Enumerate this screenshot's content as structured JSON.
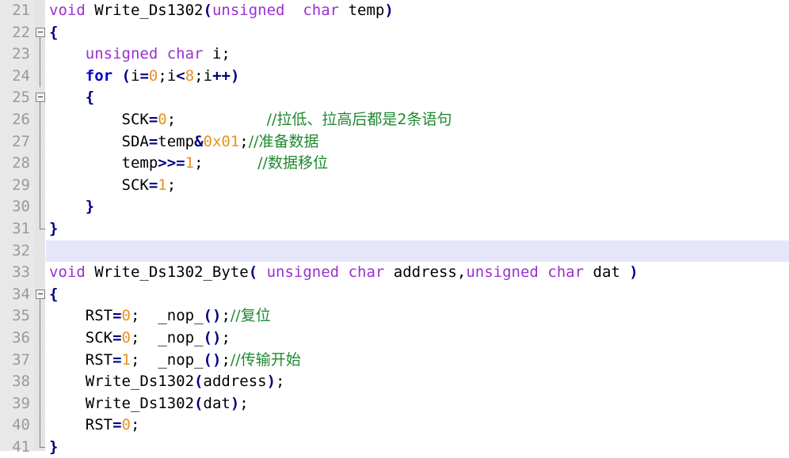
{
  "editor": {
    "title": "C source code editor",
    "language": "C",
    "first_line_number": 21,
    "last_line_number": 41,
    "current_line": 32,
    "colors": {
      "background": "#ffffff",
      "gutter_background": "#e8e8e8",
      "line_number": "#9a9a9a",
      "current_line_highlight": "#e6e6fa",
      "keyword_type": "#9b30d0",
      "keyword_control": "#0000cc",
      "operator": "#00007f",
      "number": "#e8921f",
      "comment": "#1f8a2f",
      "identifier": "#000000"
    },
    "lines": [
      {
        "number": "21",
        "fold": "none",
        "text": "void Write_Ds1302(unsigned  char temp)",
        "tokens": [
          {
            "t": "void",
            "c": "kw-type"
          },
          {
            "t": " ",
            "c": "ident"
          },
          {
            "t": "Write_Ds1302",
            "c": "ident"
          },
          {
            "t": "(",
            "c": "op"
          },
          {
            "t": "unsigned",
            "c": "kw-type"
          },
          {
            "t": "  ",
            "c": "ident"
          },
          {
            "t": "char",
            "c": "kw-type"
          },
          {
            "t": " ",
            "c": "ident"
          },
          {
            "t": "temp",
            "c": "ident"
          },
          {
            "t": ")",
            "c": "op"
          }
        ]
      },
      {
        "number": "22",
        "fold": "box",
        "text": "{",
        "tokens": [
          {
            "t": "{",
            "c": "brace"
          }
        ]
      },
      {
        "number": "23",
        "fold": "line",
        "text": "    unsigned char i;",
        "tokens": [
          {
            "t": "    ",
            "c": "ident"
          },
          {
            "t": "unsigned",
            "c": "kw-type"
          },
          {
            "t": " ",
            "c": "ident"
          },
          {
            "t": "char",
            "c": "kw-type"
          },
          {
            "t": " ",
            "c": "ident"
          },
          {
            "t": "i",
            "c": "ident"
          },
          {
            "t": ";",
            "c": "punc"
          }
        ]
      },
      {
        "number": "24",
        "fold": "line",
        "text": "    for (i=0;i<8;i++)",
        "tokens": [
          {
            "t": "    ",
            "c": "ident"
          },
          {
            "t": "for",
            "c": "kw-ctrl"
          },
          {
            "t": " ",
            "c": "ident"
          },
          {
            "t": "(",
            "c": "op"
          },
          {
            "t": "i",
            "c": "ident"
          },
          {
            "t": "=",
            "c": "op"
          },
          {
            "t": "0",
            "c": "num"
          },
          {
            "t": ";",
            "c": "punc"
          },
          {
            "t": "i",
            "c": "ident"
          },
          {
            "t": "<",
            "c": "op"
          },
          {
            "t": "8",
            "c": "num"
          },
          {
            "t": ";",
            "c": "punc"
          },
          {
            "t": "i",
            "c": "ident"
          },
          {
            "t": "++",
            "c": "op"
          },
          {
            "t": ")",
            "c": "op"
          }
        ]
      },
      {
        "number": "25",
        "fold": "box",
        "text": "    {",
        "tokens": [
          {
            "t": "    ",
            "c": "ident"
          },
          {
            "t": "{",
            "c": "brace"
          }
        ]
      },
      {
        "number": "26",
        "fold": "line",
        "text": "        SCK=0;          //拉低、拉高后都是2条语句",
        "tokens": [
          {
            "t": "        ",
            "c": "ident"
          },
          {
            "t": "SCK",
            "c": "ident"
          },
          {
            "t": "=",
            "c": "op"
          },
          {
            "t": "0",
            "c": "num"
          },
          {
            "t": ";",
            "c": "punc"
          },
          {
            "t": "          ",
            "c": "ident"
          },
          {
            "t": "//拉低、拉高后都是2条语句",
            "c": "cmt"
          }
        ]
      },
      {
        "number": "27",
        "fold": "line",
        "text": "        SDA=temp&0x01;//准备数据",
        "tokens": [
          {
            "t": "        ",
            "c": "ident"
          },
          {
            "t": "SDA",
            "c": "ident"
          },
          {
            "t": "=",
            "c": "op"
          },
          {
            "t": "temp",
            "c": "ident"
          },
          {
            "t": "&",
            "c": "op"
          },
          {
            "t": "0x01",
            "c": "num"
          },
          {
            "t": ";",
            "c": "punc"
          },
          {
            "t": "//准备数据",
            "c": "cmt"
          }
        ]
      },
      {
        "number": "28",
        "fold": "line",
        "text": "        temp>>=1;      //数据移位",
        "tokens": [
          {
            "t": "        ",
            "c": "ident"
          },
          {
            "t": "temp",
            "c": "ident"
          },
          {
            "t": ">>=",
            "c": "op"
          },
          {
            "t": "1",
            "c": "num"
          },
          {
            "t": ";",
            "c": "punc"
          },
          {
            "t": "      ",
            "c": "ident"
          },
          {
            "t": "//数据移位",
            "c": "cmt"
          }
        ]
      },
      {
        "number": "29",
        "fold": "line",
        "text": "        SCK=1;",
        "tokens": [
          {
            "t": "        ",
            "c": "ident"
          },
          {
            "t": "SCK",
            "c": "ident"
          },
          {
            "t": "=",
            "c": "op"
          },
          {
            "t": "1",
            "c": "num"
          },
          {
            "t": ";",
            "c": "punc"
          }
        ]
      },
      {
        "number": "30",
        "fold": "line-end-inner",
        "text": "    }",
        "tokens": [
          {
            "t": "    ",
            "c": "ident"
          },
          {
            "t": "}",
            "c": "brace"
          }
        ]
      },
      {
        "number": "31",
        "fold": "end",
        "text": "}",
        "tokens": [
          {
            "t": "}",
            "c": "brace"
          }
        ]
      },
      {
        "number": "32",
        "fold": "none",
        "text": "",
        "tokens": []
      },
      {
        "number": "33",
        "fold": "none",
        "text": "void Write_Ds1302_Byte( unsigned char address,unsigned char dat )",
        "tokens": [
          {
            "t": "void",
            "c": "kw-type"
          },
          {
            "t": " ",
            "c": "ident"
          },
          {
            "t": "Write_Ds1302_Byte",
            "c": "ident"
          },
          {
            "t": "(",
            "c": "op"
          },
          {
            "t": " ",
            "c": "ident"
          },
          {
            "t": "unsigned",
            "c": "kw-type"
          },
          {
            "t": " ",
            "c": "ident"
          },
          {
            "t": "char",
            "c": "kw-type"
          },
          {
            "t": " ",
            "c": "ident"
          },
          {
            "t": "address",
            "c": "ident"
          },
          {
            "t": ",",
            "c": "punc"
          },
          {
            "t": "unsigned",
            "c": "kw-type"
          },
          {
            "t": " ",
            "c": "ident"
          },
          {
            "t": "char",
            "c": "kw-type"
          },
          {
            "t": " ",
            "c": "ident"
          },
          {
            "t": "dat",
            "c": "ident"
          },
          {
            "t": " ",
            "c": "ident"
          },
          {
            "t": ")",
            "c": "op"
          }
        ]
      },
      {
        "number": "34",
        "fold": "box",
        "text": "{",
        "tokens": [
          {
            "t": "{",
            "c": "brace"
          }
        ]
      },
      {
        "number": "35",
        "fold": "line",
        "text": "    RST=0;  _nop_();//复位",
        "tokens": [
          {
            "t": "    ",
            "c": "ident"
          },
          {
            "t": "RST",
            "c": "ident"
          },
          {
            "t": "=",
            "c": "op"
          },
          {
            "t": "0",
            "c": "num"
          },
          {
            "t": ";",
            "c": "punc"
          },
          {
            "t": "  ",
            "c": "ident"
          },
          {
            "t": "_nop_",
            "c": "ident"
          },
          {
            "t": "()",
            "c": "op"
          },
          {
            "t": ";",
            "c": "punc"
          },
          {
            "t": "//复位",
            "c": "cmt"
          }
        ]
      },
      {
        "number": "36",
        "fold": "line",
        "text": "    SCK=0;  _nop_();",
        "tokens": [
          {
            "t": "    ",
            "c": "ident"
          },
          {
            "t": "SCK",
            "c": "ident"
          },
          {
            "t": "=",
            "c": "op"
          },
          {
            "t": "0",
            "c": "num"
          },
          {
            "t": ";",
            "c": "punc"
          },
          {
            "t": "  ",
            "c": "ident"
          },
          {
            "t": "_nop_",
            "c": "ident"
          },
          {
            "t": "()",
            "c": "op"
          },
          {
            "t": ";",
            "c": "punc"
          }
        ]
      },
      {
        "number": "37",
        "fold": "line",
        "text": "    RST=1;  _nop_();//传输开始",
        "tokens": [
          {
            "t": "    ",
            "c": "ident"
          },
          {
            "t": "RST",
            "c": "ident"
          },
          {
            "t": "=",
            "c": "op"
          },
          {
            "t": "1",
            "c": "num"
          },
          {
            "t": ";",
            "c": "punc"
          },
          {
            "t": "  ",
            "c": "ident"
          },
          {
            "t": "_nop_",
            "c": "ident"
          },
          {
            "t": "()",
            "c": "op"
          },
          {
            "t": ";",
            "c": "punc"
          },
          {
            "t": "//传输开始",
            "c": "cmt"
          }
        ]
      },
      {
        "number": "38",
        "fold": "line",
        "text": "    Write_Ds1302(address);",
        "tokens": [
          {
            "t": "    ",
            "c": "ident"
          },
          {
            "t": "Write_Ds1302",
            "c": "ident"
          },
          {
            "t": "(",
            "c": "op"
          },
          {
            "t": "address",
            "c": "ident"
          },
          {
            "t": ")",
            "c": "op"
          },
          {
            "t": ";",
            "c": "punc"
          }
        ]
      },
      {
        "number": "39",
        "fold": "line",
        "text": "    Write_Ds1302(dat);",
        "tokens": [
          {
            "t": "    ",
            "c": "ident"
          },
          {
            "t": "Write_Ds1302",
            "c": "ident"
          },
          {
            "t": "(",
            "c": "op"
          },
          {
            "t": "dat",
            "c": "ident"
          },
          {
            "t": ")",
            "c": "op"
          },
          {
            "t": ";",
            "c": "punc"
          }
        ]
      },
      {
        "number": "40",
        "fold": "line",
        "text": "    RST=0;",
        "tokens": [
          {
            "t": "    ",
            "c": "ident"
          },
          {
            "t": "RST",
            "c": "ident"
          },
          {
            "t": "=",
            "c": "op"
          },
          {
            "t": "0",
            "c": "num"
          },
          {
            "t": ";",
            "c": "punc"
          }
        ]
      },
      {
        "number": "41",
        "fold": "end",
        "text": "}",
        "tokens": [
          {
            "t": "}",
            "c": "brace"
          }
        ]
      }
    ]
  }
}
